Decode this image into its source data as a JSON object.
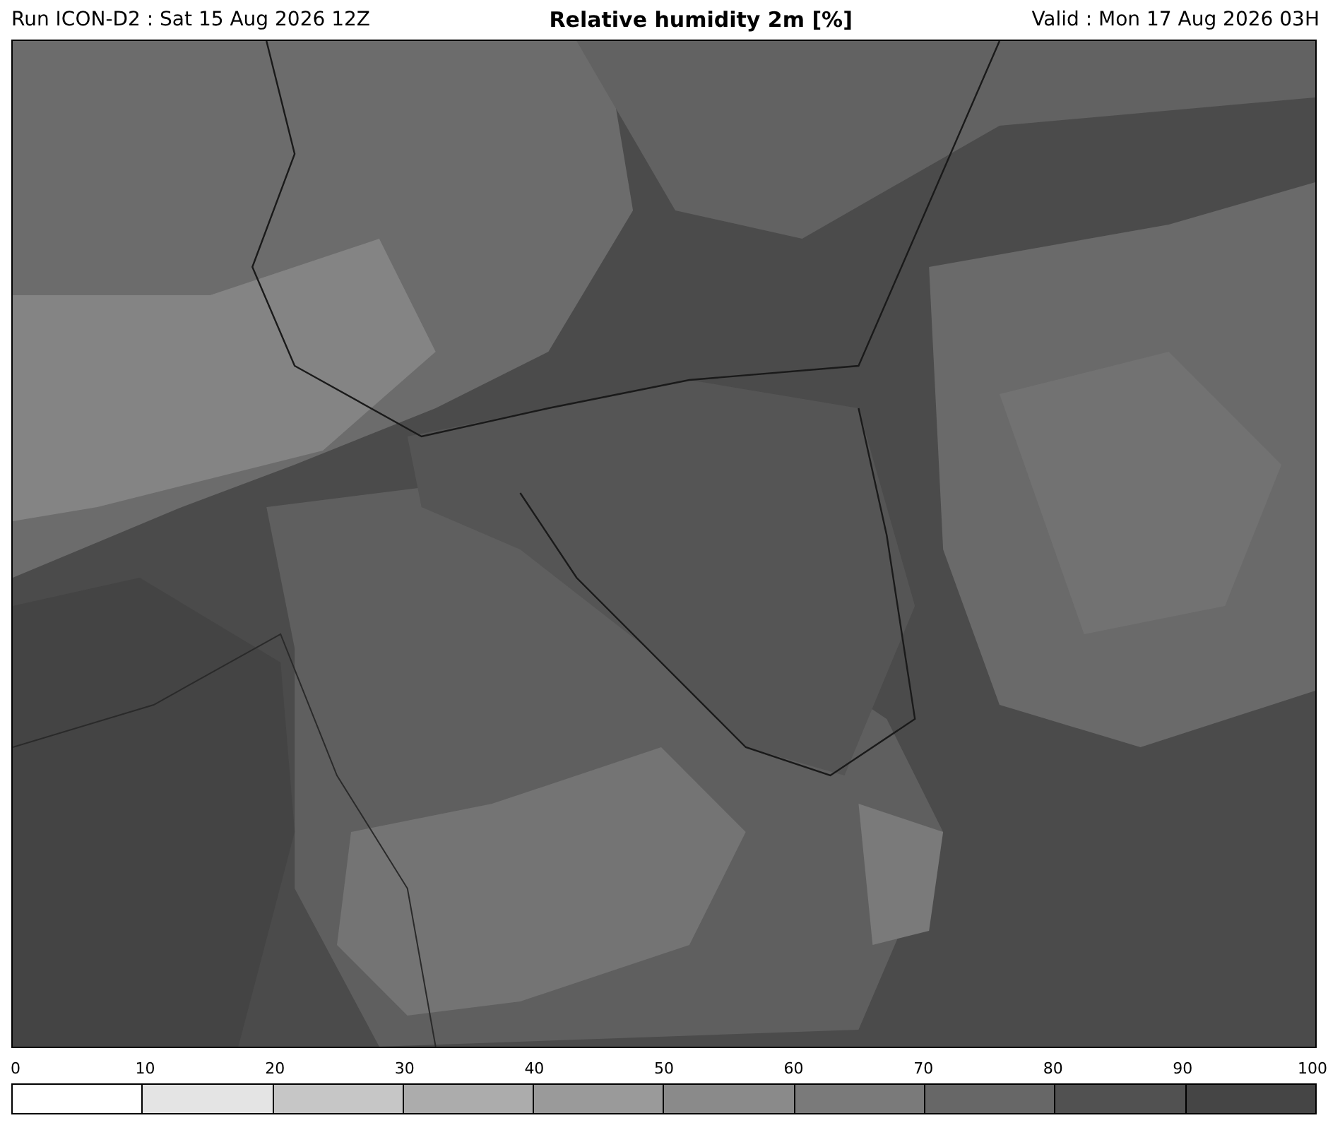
{
  "header": {
    "run": "Run ICON-D2 : Sat 15 Aug 2026 12Z",
    "title": "Relative humidity 2m [%]",
    "valid": "Valid : Mon 17 Aug 2026 03H"
  },
  "legend": {
    "ticks": [
      "0",
      "10",
      "20",
      "30",
      "40",
      "50",
      "60",
      "70",
      "80",
      "90",
      "100"
    ],
    "segments": [
      {
        "color": "#ffffff"
      },
      {
        "color": "#e4e4e4"
      },
      {
        "color": "#c6c6c6"
      },
      {
        "color": "#acacac"
      },
      {
        "color": "#9a9a9a"
      },
      {
        "color": "#8a8a8a"
      },
      {
        "color": "#7a7a7a"
      },
      {
        "color": "#676767"
      },
      {
        "color": "#515151"
      },
      {
        "color": "#454545"
      }
    ]
  }
}
